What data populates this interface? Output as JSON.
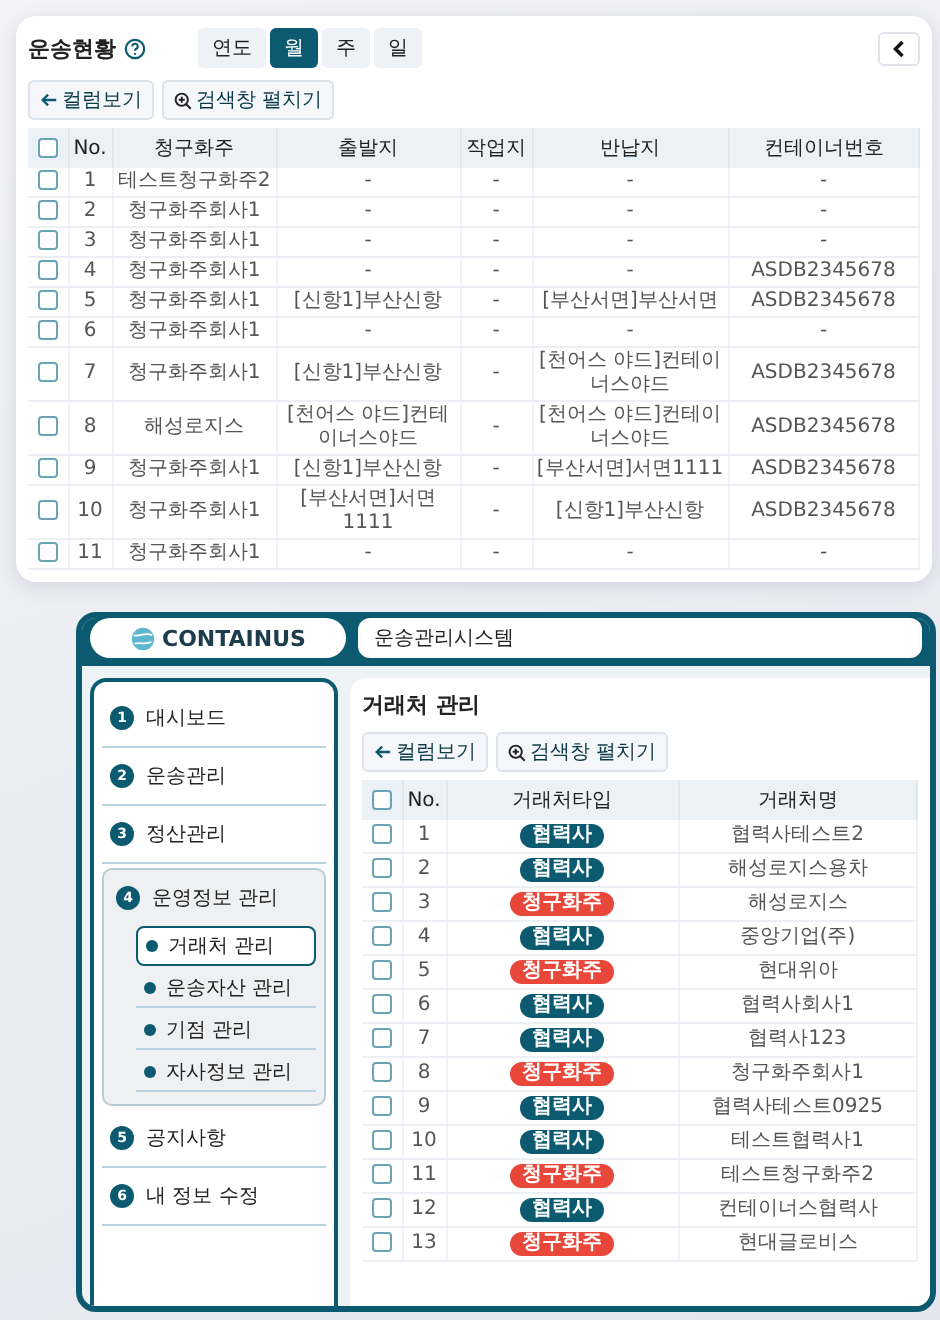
{
  "transport_window": {
    "title": "운송현황",
    "period_tabs": [
      {
        "label": "연도",
        "selected": false
      },
      {
        "label": "월",
        "selected": true
      },
      {
        "label": "주",
        "selected": false
      },
      {
        "label": "일",
        "selected": false
      }
    ],
    "buttons": [
      {
        "kind": "columns",
        "label": "컬럼보기"
      },
      {
        "kind": "search",
        "label": "검색창 펼치기"
      }
    ],
    "table": {
      "header_checked": false,
      "columns": [
        "No.",
        "청구화주",
        "출발지",
        "작업지",
        "반납지",
        "컨테이너번호"
      ],
      "rows": [
        {
          "checked": false,
          "cells": [
            "1",
            "테스트청구화주2",
            "-",
            "-",
            "-",
            "-"
          ]
        },
        {
          "checked": false,
          "cells": [
            "2",
            "청구화주회사1",
            "-",
            "-",
            "-",
            "-"
          ]
        },
        {
          "checked": false,
          "cells": [
            "3",
            "청구화주회사1",
            "-",
            "-",
            "-",
            "-"
          ]
        },
        {
          "checked": false,
          "cells": [
            "4",
            "청구화주회사1",
            "-",
            "-",
            "-",
            "ASDB2345678"
          ]
        },
        {
          "checked": false,
          "cells": [
            "5",
            "청구화주회사1",
            "[신항1]부산신항",
            "-",
            "[부산서면]부산서면",
            "ASDB2345678"
          ]
        },
        {
          "checked": false,
          "cells": [
            "6",
            "청구화주회사1",
            "-",
            "-",
            "-",
            "-"
          ]
        },
        {
          "checked": false,
          "cells": [
            "7",
            "청구화주회사1",
            "[신항1]부산신항",
            "-",
            "[천어스 야드]컨테이너스야드",
            "ASDB2345678"
          ]
        },
        {
          "checked": false,
          "cells": [
            "8",
            "해성로지스",
            "[천어스 야드]컨테이너스야드",
            "-",
            "[천어스 야드]컨테이너스야드",
            "ASDB2345678"
          ]
        },
        {
          "checked": false,
          "cells": [
            "9",
            "청구화주회사1",
            "[신항1]부산신항",
            "-",
            "[부산서면]서면1111",
            "ASDB2345678"
          ]
        },
        {
          "checked": false,
          "cells": [
            "10",
            "청구화주회사1",
            "[부산서면]서면1111",
            "-",
            "[신항1]부산신항",
            "ASDB2345678"
          ]
        },
        {
          "checked": false,
          "cells": [
            "11",
            "청구화주회사1",
            "-",
            "-",
            "-",
            "-"
          ]
        }
      ]
    }
  },
  "partner_window": {
    "logo": "CONTAINUS",
    "system_title": "운송관리시스템",
    "sidebar": {
      "items": [
        {
          "number": "1",
          "label": "대시보드",
          "expanded": false
        },
        {
          "number": "2",
          "label": "운송관리",
          "expanded": false
        },
        {
          "number": "3",
          "label": "정산관리",
          "expanded": false
        },
        {
          "number": "4",
          "label": "운영정보 관리",
          "expanded": true,
          "children": [
            {
              "label": "거래처 관리",
              "selected": true
            },
            {
              "label": "운송자산 관리",
              "selected": false
            },
            {
              "label": "기점 관리",
              "selected": false
            },
            {
              "label": "자사정보 관리",
              "selected": false
            }
          ]
        },
        {
          "number": "5",
          "label": "공지사항",
          "expanded": false
        },
        {
          "number": "6",
          "label": "내 정보 수정",
          "expanded": false
        }
      ]
    },
    "title": "거래처 관리",
    "buttons": [
      {
        "kind": "columns",
        "label": "컬럼보기"
      },
      {
        "kind": "search",
        "label": "검색창 펼치기"
      }
    ],
    "table": {
      "header_checked": false,
      "columns": [
        "No.",
        "거래처타입",
        "거래처명"
      ],
      "rows": [
        {
          "checked": false,
          "no": "1",
          "kind": "partner",
          "type": "협력사",
          "name": "협력사테스트2"
        },
        {
          "checked": false,
          "no": "2",
          "kind": "partner",
          "type": "협력사",
          "name": "해성로지스용차"
        },
        {
          "checked": false,
          "no": "3",
          "kind": "shipper",
          "type": "청구화주",
          "name": "해성로지스"
        },
        {
          "checked": false,
          "no": "4",
          "kind": "partner",
          "type": "협력사",
          "name": "중앙기업(주)"
        },
        {
          "checked": false,
          "no": "5",
          "kind": "shipper",
          "type": "청구화주",
          "name": "현대위아"
        },
        {
          "checked": false,
          "no": "6",
          "kind": "partner",
          "type": "협력사",
          "name": "협력사회사1"
        },
        {
          "checked": false,
          "no": "7",
          "kind": "partner",
          "type": "협력사",
          "name": "협력사123"
        },
        {
          "checked": false,
          "no": "8",
          "kind": "shipper",
          "type": "청구화주",
          "name": "청구화주회사1"
        },
        {
          "checked": false,
          "no": "9",
          "kind": "partner",
          "type": "협력사",
          "name": "협력사테스트0925"
        },
        {
          "checked": false,
          "no": "10",
          "kind": "partner",
          "type": "협력사",
          "name": "테스트협력사1"
        },
        {
          "checked": false,
          "no": "11",
          "kind": "shipper",
          "type": "청구화주",
          "name": "테스트청구화주2"
        },
        {
          "checked": false,
          "no": "12",
          "kind": "partner",
          "type": "협력사",
          "name": "컨테이너스협력사"
        },
        {
          "checked": false,
          "no": "13",
          "kind": "shipper",
          "type": "청구화주",
          "name": "현대글로비스"
        }
      ]
    }
  }
}
